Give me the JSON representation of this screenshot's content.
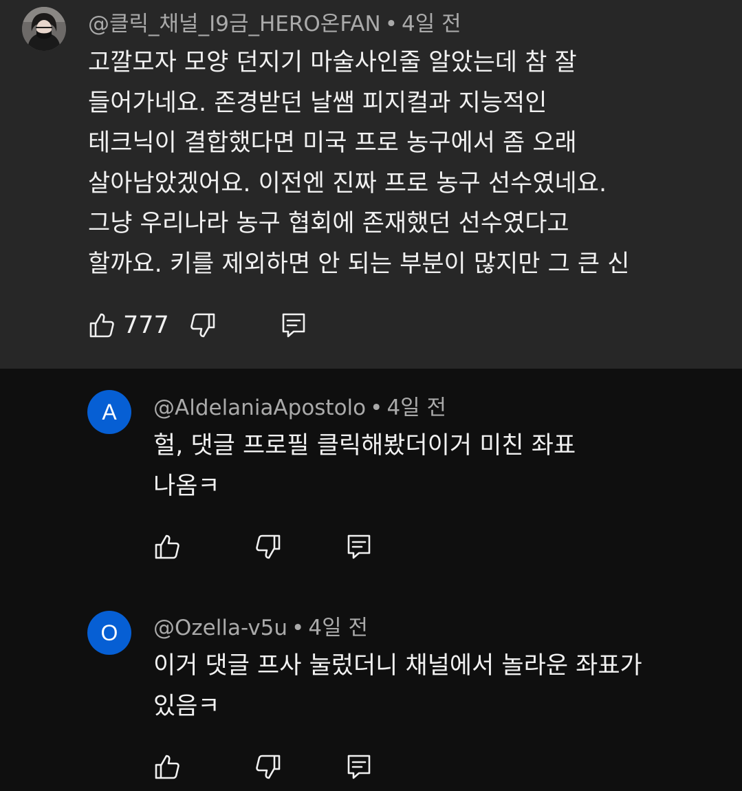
{
  "comments": [
    {
      "handle": "@클릭_채널_I9금_HERO온FAN",
      "time": "4일 전",
      "avatar_icon": "profile-photo",
      "lines": [
        "고깔모자 모양 던지기 마술사인줄 알았는데 참 잘",
        "들어가네요. 존경받던 날쌤 피지컬과 지능적인",
        "테크닉이 결합했다면 미국 프로 농구에서 좀 오래",
        "살아남았겠어요. 이전엔 진짜 프로 농구 선수였네요.",
        "그냥 우리나라 농구 협회에 존재했던 선수였다고",
        "할까요. 키를 제외하면 안 되는 부분이 많지만 그 큰 신"
      ],
      "likes": "777"
    },
    {
      "handle": "@AldelaniaApostolo",
      "time": "4일 전",
      "avatar_letter": "A",
      "avatar_color": "#065fd4",
      "lines": [
        "헐, 댓글 프로필 클릭해봤더이거 미친 좌표",
        "나옴ㅋ"
      ]
    },
    {
      "handle": "@Ozella-v5u",
      "time": "4일 전",
      "avatar_letter": "O",
      "avatar_color": "#065fd4",
      "lines": [
        "이거 댓글 프사 눌렀더니 채널에서 놀라운 좌표가",
        "있음ㅋ"
      ]
    }
  ],
  "separator": "•",
  "icons": {
    "like": "thumbs-up-icon",
    "dislike": "thumbs-down-icon",
    "reply": "reply-comment-icon"
  },
  "colors": {
    "background": "#0f0f0f",
    "highlight": "#272727",
    "meta_text": "#aaaaaa",
    "body_text": "#f1f1f1",
    "avatar_blue": "#065fd4"
  }
}
